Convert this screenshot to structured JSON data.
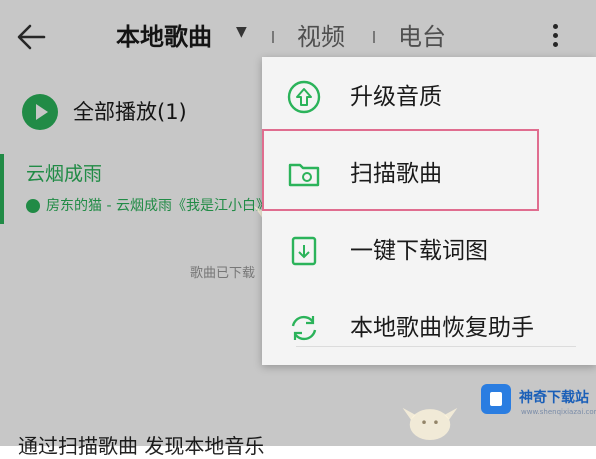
{
  "header": {
    "back_icon": "arrow-left-icon",
    "tabs": [
      {
        "label": "本地歌曲",
        "active": true
      },
      {
        "label": "视频",
        "active": false
      },
      {
        "label": "电台",
        "active": false
      }
    ],
    "dropdown_icon": "caret-down-icon",
    "more_icon": "more-vertical-icon"
  },
  "play_all": {
    "label": "全部播放(1)",
    "icon": "play-circle-icon"
  },
  "song": {
    "title": "云烟成雨",
    "subtitle": "房东的猫 - 云烟成雨《我是江小白》"
  },
  "scanned_note": "歌曲已下载",
  "bottom_text": "通过扫描歌曲 发现本地音乐",
  "menu": {
    "items": [
      {
        "label": "升级音质",
        "icon": "upgrade-quality-icon"
      },
      {
        "label": "扫描歌曲",
        "icon": "scan-folder-icon",
        "highlighted": true
      },
      {
        "label": "一键下载词图",
        "icon": "download-lyrics-icon"
      },
      {
        "label": "本地歌曲恢复助手",
        "icon": "restore-sync-icon"
      }
    ]
  },
  "watermark": {
    "brand": "神奇下载站",
    "domain": "www.shenqixiazai.com"
  },
  "colors": {
    "accent": "#2bb35a",
    "highlight_border": "#e06d8f",
    "brand_blue": "#2a7de1"
  }
}
